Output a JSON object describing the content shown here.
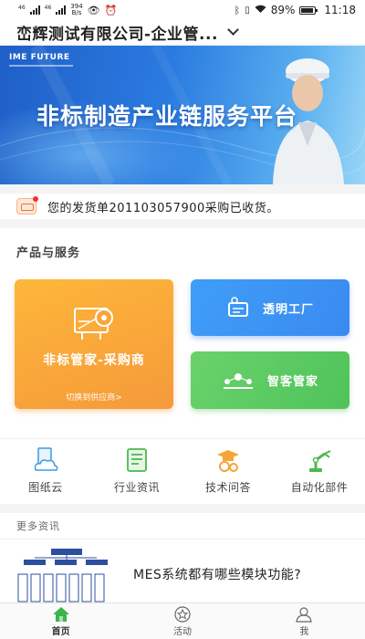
{
  "status_bar": {
    "network_left": "46",
    "network_right": "46",
    "speed_value": "394",
    "speed_unit": "B/s",
    "battery": "89%",
    "time": "11:18"
  },
  "header": {
    "company_name": "峦辉测试有限公司-企业管..."
  },
  "banner": {
    "logo_text": "IME FUTURE",
    "title": "非标制造产业链服务平台"
  },
  "notice": {
    "text": "您的发货单201103057900采购已收货。"
  },
  "products": {
    "section_title": "产品与服务",
    "main_card": {
      "title": "非标管家-采购商",
      "subtitle": "切换到供应商>"
    },
    "factory_card": {
      "label": "透明工厂"
    },
    "customer_card": {
      "label": "智客管家"
    }
  },
  "quick_links": [
    {
      "label": "图纸云",
      "icon": "cloud-doc-icon"
    },
    {
      "label": "行业资讯",
      "icon": "news-icon"
    },
    {
      "label": "技术问答",
      "icon": "graduation-gear-icon"
    },
    {
      "label": "自动化部件",
      "icon": "robot-arm-icon"
    }
  ],
  "more_news": {
    "header": "更多资讯",
    "items": [
      {
        "title": "MES系统都有哪些模块功能?"
      }
    ]
  },
  "tab_bar": {
    "tabs": [
      {
        "label": "首页",
        "icon": "home-icon",
        "active": true
      },
      {
        "label": "活动",
        "icon": "star-icon",
        "active": false
      },
      {
        "label": "我",
        "icon": "user-icon",
        "active": false
      }
    ]
  },
  "colors": {
    "orange_card": "#f9a53a",
    "blue_card": "#3a8af0",
    "green_card": "#4fc35a",
    "banner_blue": "#2a7be0",
    "home_active": "#3bb54a"
  }
}
